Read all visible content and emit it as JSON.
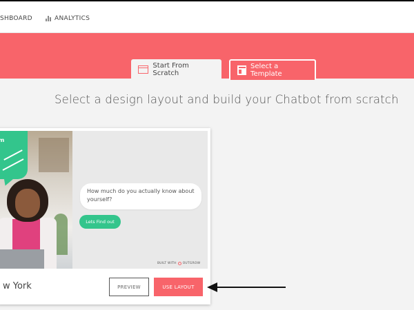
{
  "nav": {
    "dashboard_label": "SHBOARD",
    "analytics_label": "ANALYTICS",
    "analytics_icon": "bar-chart-icon"
  },
  "tabs": [
    {
      "label": "Start From Scratch",
      "icon": "layout-icon",
      "active": true
    },
    {
      "label": "Select a Template",
      "icon": "template-icon",
      "active": false
    }
  ],
  "headline": "Select a design layout and build your Chatbot from scratch",
  "card": {
    "speech_text": "m",
    "chat_question": "How much do you actually know about yourself?",
    "chat_button_label": "Lets Find out",
    "built_with_label": "BUILT WITH",
    "brand_label": "OUTGROW",
    "city_label": "w York",
    "preview_button_label": "PREVIEW",
    "use_layout_button_label": "USE LAYOUT"
  },
  "colors": {
    "accent": "#f8646a",
    "chat_green": "#33c58c",
    "background": "#f3f3f3"
  },
  "annotation": {
    "icon": "arrow-left-icon"
  }
}
